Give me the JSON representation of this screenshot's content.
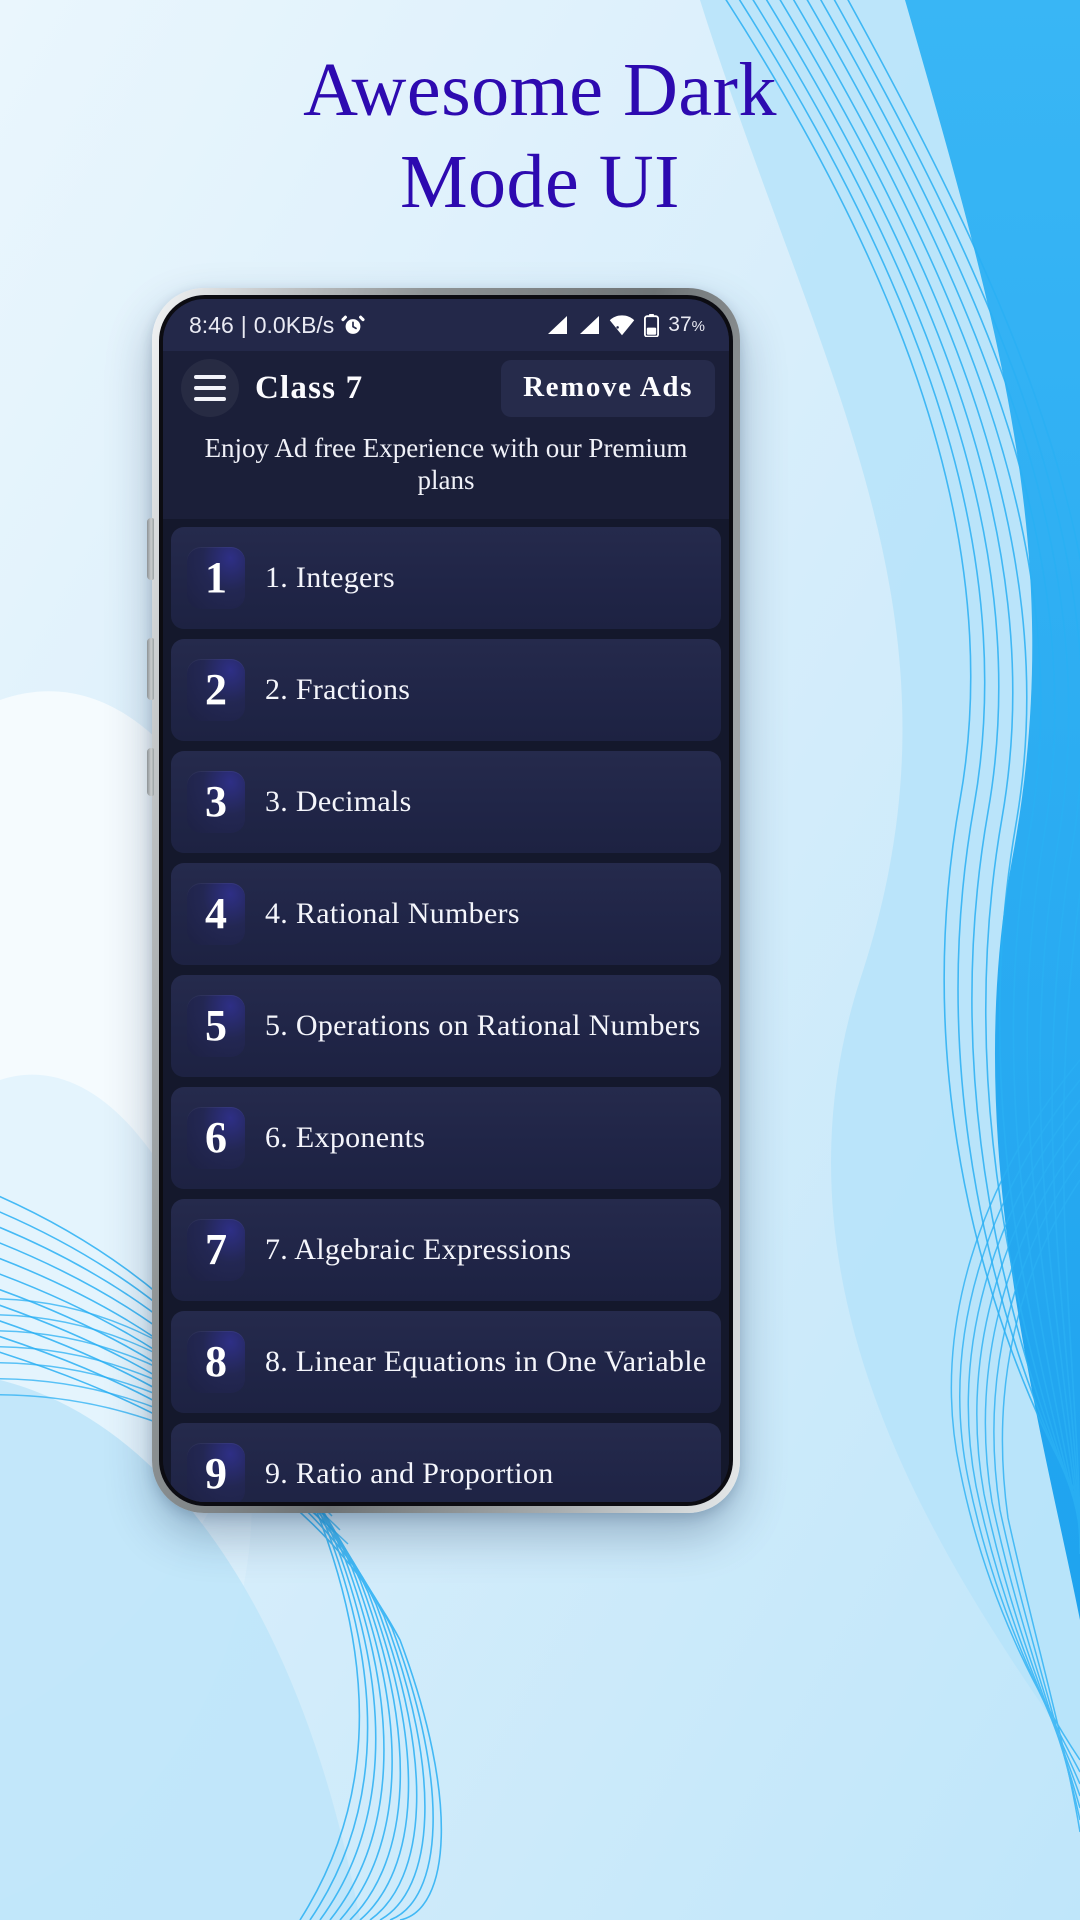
{
  "promo": {
    "headline_line1": "Awesome Dark",
    "headline_line2": "Mode UI",
    "headline_color": "#2d0ab0",
    "background_color": "#dcf0fb",
    "wave_color": "#22a7f0"
  },
  "statusbar": {
    "time": "8:46",
    "separator": "|",
    "network_speed": "0.0KB/s",
    "alarm_icon": "alarm-clock-icon",
    "signal_icon": "signal-bars-icon",
    "signal_icon_2": "signal-bars-icon",
    "wifi_icon": "wifi-icon",
    "battery_icon": "battery-icon",
    "battery_level": "37",
    "battery_unit": "%"
  },
  "appbar": {
    "menu_icon": "hamburger-menu-icon",
    "title": "Class  7",
    "remove_ads_label": "Remove Ads"
  },
  "promo_strip": {
    "text": "Enjoy Ad free Experience with our Premium plans"
  },
  "chapters": [
    {
      "num": "1",
      "label": "1. Integers"
    },
    {
      "num": "2",
      "label": "2. Fractions"
    },
    {
      "num": "3",
      "label": "3. Decimals"
    },
    {
      "num": "4",
      "label": "4. Rational Numbers"
    },
    {
      "num": "5",
      "label": "5. Operations on Rational Numbers"
    },
    {
      "num": "6",
      "label": "6. Exponents"
    },
    {
      "num": "7",
      "label": "7. Algebraic Expressions"
    },
    {
      "num": "8",
      "label": "8. Linear Equations in One Variable"
    },
    {
      "num": "9",
      "label": "9. Ratio and Proportion"
    }
  ],
  "device": {
    "volume_up_button": "volume-up-button",
    "volume_down_button": "volume-down-button",
    "power_button": "power-button"
  }
}
